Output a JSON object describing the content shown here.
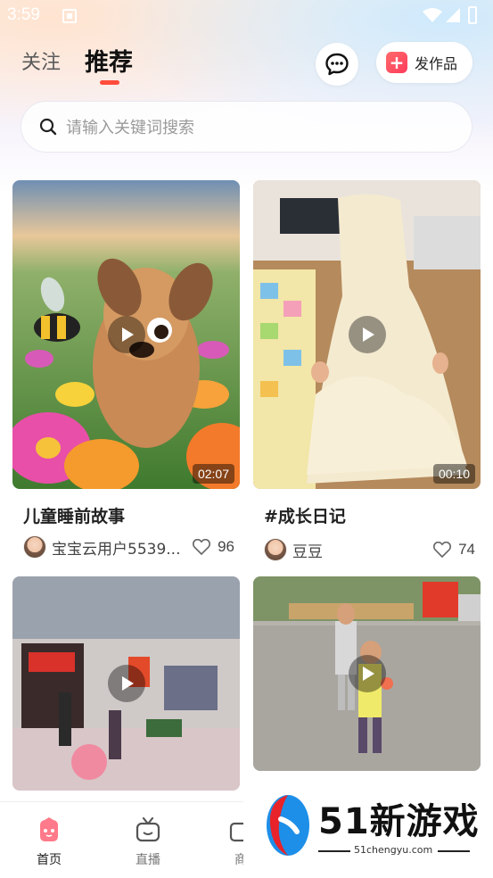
{
  "status_bar": {
    "time": "3:59"
  },
  "header": {
    "tab_follow": "关注",
    "tab_recommend": "推荐",
    "publish_label": "发作品"
  },
  "search": {
    "placeholder": "请输入关键词搜索"
  },
  "feed": [
    {
      "title": "儿童睡前故事",
      "author": "宝宝云用户5539...",
      "likes": "96",
      "duration": "02:07"
    },
    {
      "title": "#成长日记",
      "author": "豆豆",
      "likes": "74",
      "duration": "00:10"
    },
    {
      "title": "",
      "author": "",
      "likes": "",
      "duration": ""
    },
    {
      "title": "",
      "author": "",
      "likes": "",
      "duration": ""
    }
  ],
  "bottom_nav": {
    "home": "首页",
    "live": "直播",
    "mall_partial": "商"
  },
  "watermark": {
    "brand": "51新游戏",
    "url": "51chengyu.com"
  },
  "colors": {
    "accent": "#ff4d3b",
    "publish_icon": "#ff4d5e",
    "nav_active": "#ff7a7a"
  }
}
